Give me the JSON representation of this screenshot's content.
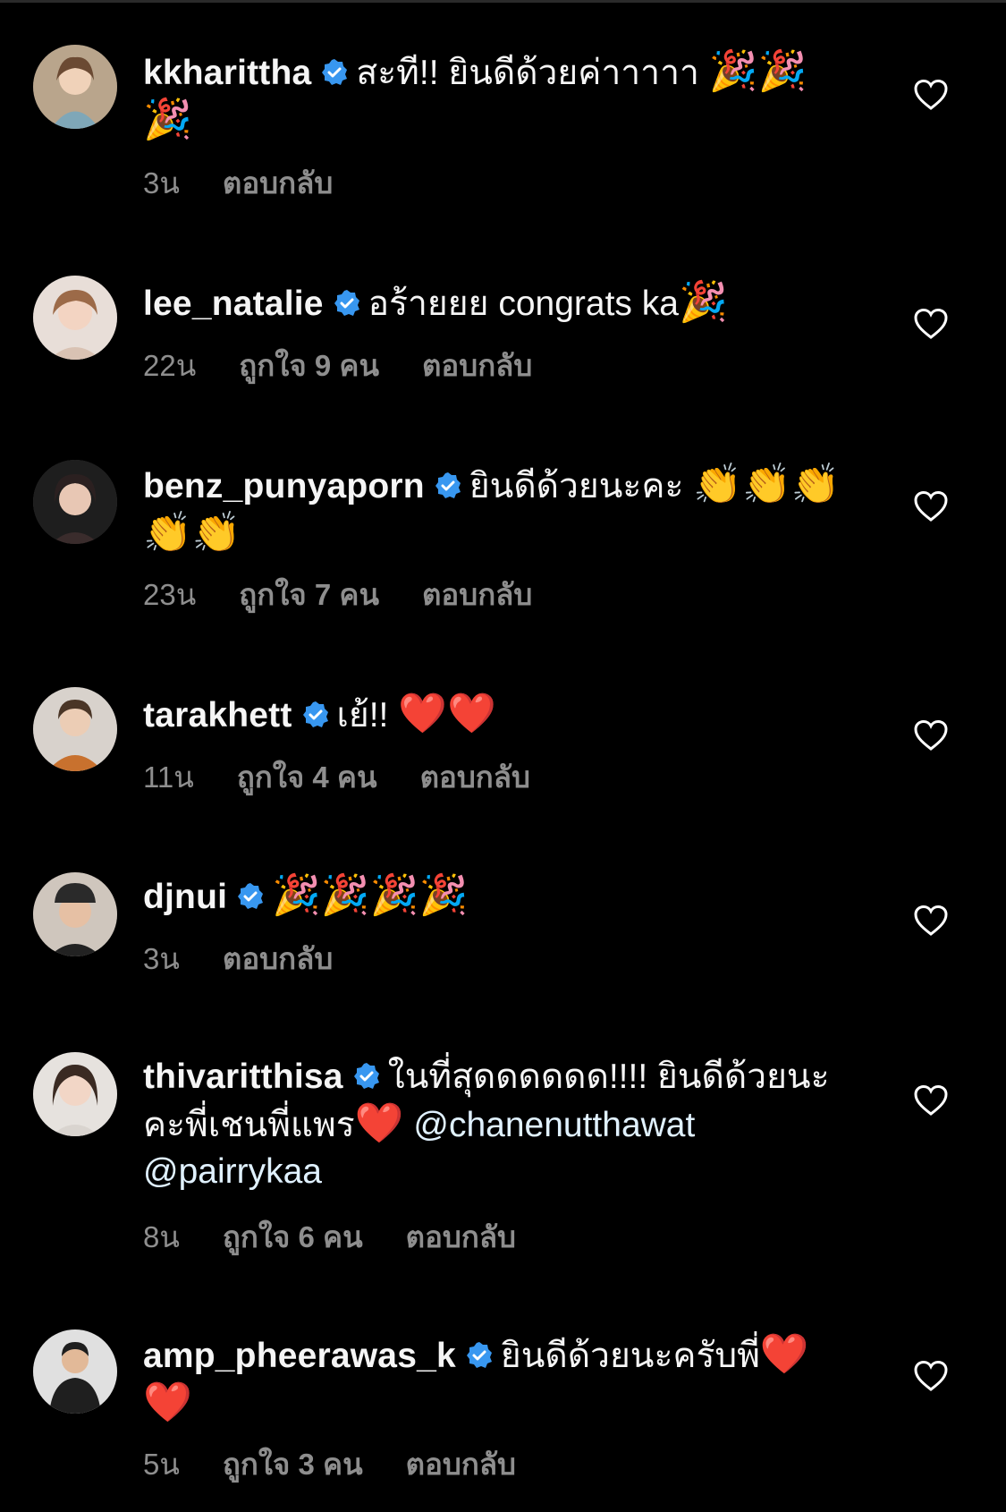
{
  "colors": {
    "background": "#000000",
    "text": "#f5f5f5",
    "meta": "#8e8e8e",
    "verified": "#3897f0",
    "heart": "#e41e3f"
  },
  "icons": {
    "verified": "verified-badge-icon",
    "like": "heart-outline-icon"
  },
  "comments": [
    {
      "username": "kkharittha",
      "text": "สะที!! ยินดีด้วยค่าาาาา ",
      "emojis": "🎉🎉🎉",
      "time": "3น",
      "likes": "",
      "reply": "ตอบกลับ"
    },
    {
      "username": "lee_natalie",
      "text": "อร้ายยย congrats ka",
      "emojis": "🎉",
      "time": "22น",
      "likes": "ถูกใจ 9 คน",
      "reply": "ตอบกลับ"
    },
    {
      "username": "benz_punyaporn",
      "text": "ยินดีด้วยนะคะ ",
      "emojis": "👏👏👏👏👏",
      "time": "23น",
      "likes": "ถูกใจ 7 คน",
      "reply": "ตอบกลับ"
    },
    {
      "username": "tarakhett",
      "text": "เย้!! ",
      "emojis": "❤️❤️",
      "time": "11น",
      "likes": "ถูกใจ 4 คน",
      "reply": "ตอบกลับ"
    },
    {
      "username": "djnui",
      "text": "",
      "emojis": "🎉🎉🎉🎉",
      "time": "3น",
      "likes": "",
      "reply": "ตอบกลับ"
    },
    {
      "username": "thivaritthisa",
      "text": "ในที่สุดดดดดด!!!! ยินดีด้วยนะคะพี่เชนพี่แพร",
      "emojis": "❤️",
      "text2": " @chanenutthawat @pairrykaa",
      "time": "8น",
      "likes": "ถูกใจ 6 คน",
      "reply": "ตอบกลับ"
    },
    {
      "username": "amp_pheerawas_k",
      "text": "ยินดีด้วยนะครับพี่",
      "emojis": "❤️❤️",
      "time": "5น",
      "likes": "ถูกใจ 3 คน",
      "reply": "ตอบกลับ"
    }
  ]
}
